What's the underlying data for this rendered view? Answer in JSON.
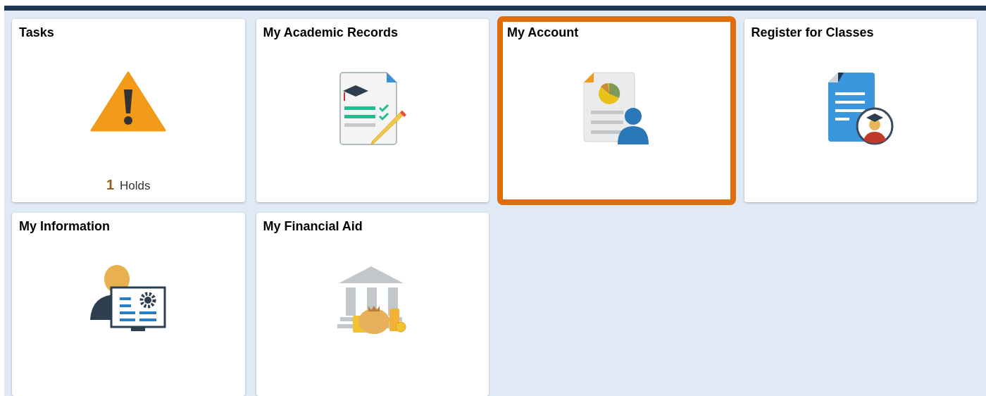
{
  "tiles": [
    {
      "title": "Tasks",
      "kind": "warning",
      "highlighted": false,
      "count": "1",
      "count_label": "Holds"
    },
    {
      "title": "My Academic Records",
      "kind": "records",
      "highlighted": false
    },
    {
      "title": "My Account",
      "kind": "account",
      "highlighted": true
    },
    {
      "title": "Register for Classes",
      "kind": "register",
      "highlighted": false
    },
    {
      "title": "My Information",
      "kind": "information",
      "highlighted": false
    },
    {
      "title": "My Financial Aid",
      "kind": "financial-aid",
      "highlighted": false
    }
  ]
}
